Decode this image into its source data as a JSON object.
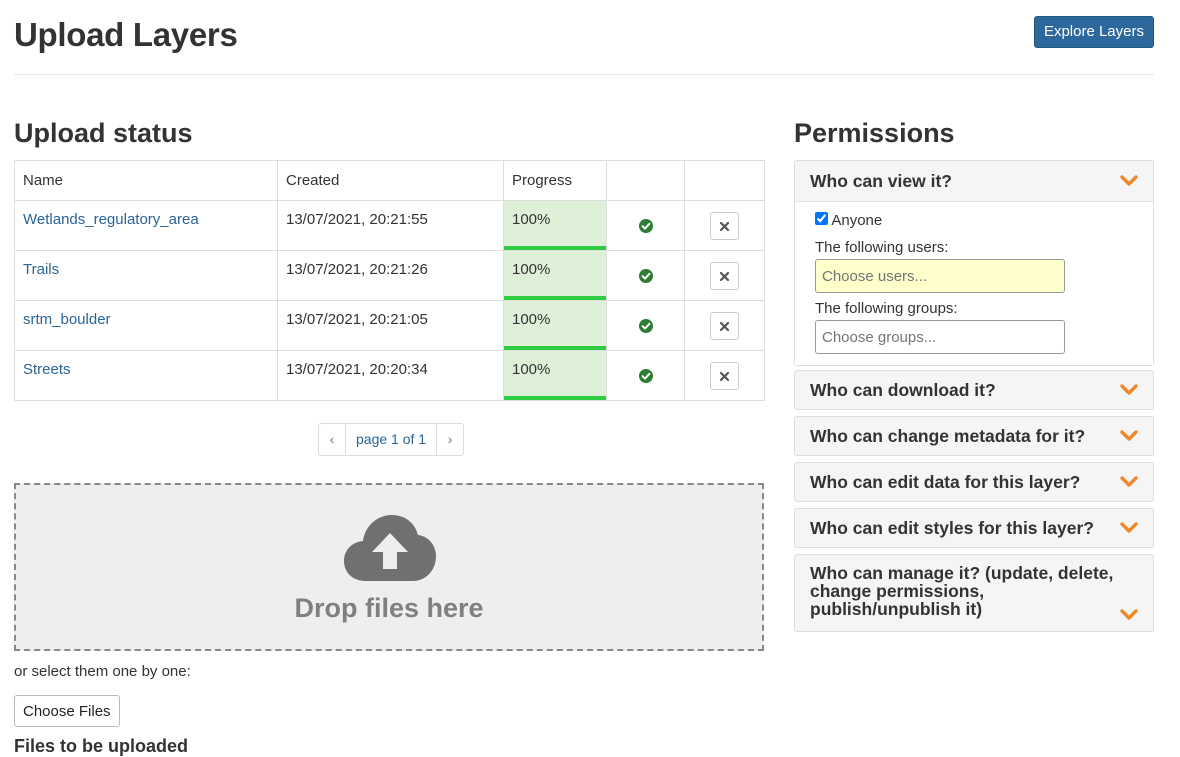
{
  "header": {
    "title": "Upload Layers",
    "explore_button": "Explore Layers"
  },
  "upload_status": {
    "title": "Upload status",
    "columns": [
      "Name",
      "Created",
      "Progress",
      "",
      ""
    ],
    "rows": [
      {
        "name": "Wetlands_regulatory_area",
        "created": "13/07/2021, 20:21:55",
        "progress": "100%",
        "progress_value": 100
      },
      {
        "name": "Trails",
        "created": "13/07/2021, 20:21:26",
        "progress": "100%",
        "progress_value": 100
      },
      {
        "name": "srtm_boulder",
        "created": "13/07/2021, 20:21:05",
        "progress": "100%",
        "progress_value": 100
      },
      {
        "name": "Streets",
        "created": "13/07/2021, 20:20:34",
        "progress": "100%",
        "progress_value": 100
      }
    ],
    "status_icon": "check-circle-icon",
    "remove_icon": "times-icon",
    "pagination": {
      "prev": "‹",
      "label": "page 1 of 1",
      "next": "›"
    }
  },
  "dropzone": {
    "icon": "cloud-upload-icon",
    "label": "Drop files here"
  },
  "select_text": "or select them one by one:",
  "choose_files": "Choose Files",
  "files_title": "Files to be uploaded",
  "permissions": {
    "title": "Permissions",
    "view": {
      "title": "Who can view it?",
      "anyone_label": "Anyone",
      "anyone_checked": true,
      "users_label": "The following users:",
      "users_placeholder": "Choose users...",
      "groups_label": "The following groups:",
      "groups_placeholder": "Choose groups..."
    },
    "panels": [
      {
        "title": "Who can download it?"
      },
      {
        "title": "Who can change metadata for it?"
      },
      {
        "title": "Who can edit data for this layer?"
      },
      {
        "title": "Who can edit styles for this layer?"
      },
      {
        "title": "Who can manage it? (update, delete, change permissions, publish/unpublish it)"
      }
    ]
  },
  "colors": {
    "primary": "#2c689c",
    "link": "#2a6496",
    "success_bg": "#dff0d8",
    "success_bar": "#2ecc40",
    "check": "#2e7d32",
    "chevron": "#f0882a",
    "highlight_input": "#ffffcc"
  }
}
